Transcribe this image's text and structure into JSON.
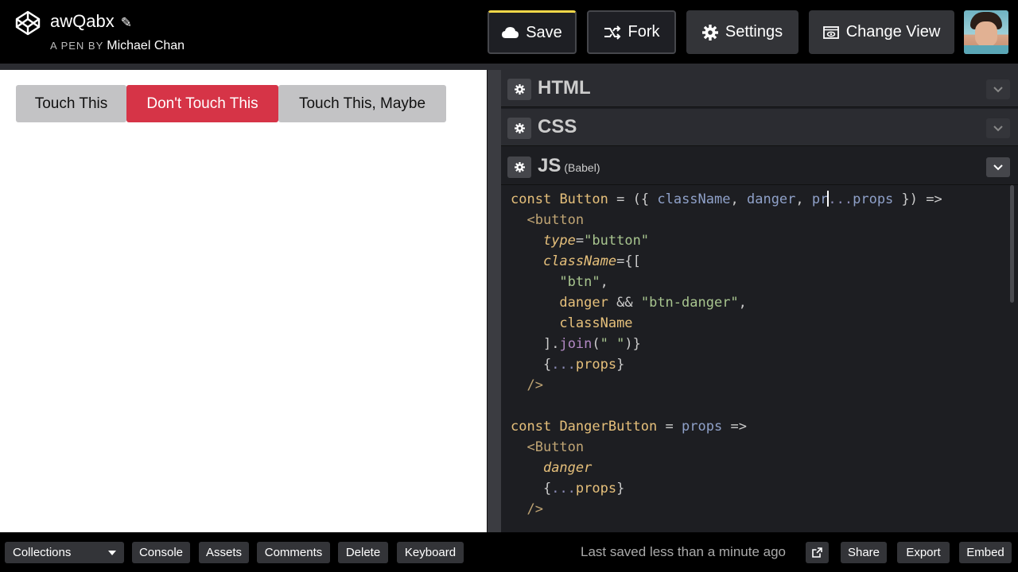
{
  "header": {
    "pen_title": "awQabx",
    "pen_by": "A PEN BY",
    "author": "Michael Chan",
    "buttons": {
      "save": "Save",
      "fork": "Fork",
      "settings": "Settings",
      "change_view": "Change View"
    },
    "colors": {
      "save_accent": "#f2d749",
      "background": "#000000"
    }
  },
  "preview": {
    "buttons": [
      {
        "label": "Touch This",
        "style": "default"
      },
      {
        "label": "Don't Touch This",
        "style": "danger"
      },
      {
        "label": "Touch This, Maybe",
        "style": "default"
      }
    ],
    "colors": {
      "danger": "#d63447",
      "default": "#c3c3c5"
    }
  },
  "editors": {
    "html": {
      "title": "HTML"
    },
    "css": {
      "title": "CSS"
    },
    "js": {
      "title": "JS",
      "preprocessor": "(Babel)"
    }
  },
  "code": {
    "lines": [
      "const Button = ({ className, danger, pr...props }) =>",
      "  <button",
      "    type=\"button\"",
      "    className={[",
      "      \"btn\",",
      "      danger && \"btn-danger\",",
      "      className",
      "    ].join(\" \")}",
      "    {...props}",
      "  />",
      "",
      "const DangerButton = props =>",
      "  <Button",
      "    danger",
      "    {...props}",
      "  />"
    ]
  },
  "footer": {
    "collections": "Collections",
    "console": "Console",
    "assets": "Assets",
    "comments": "Comments",
    "delete": "Delete",
    "keyboard": "Keyboard",
    "status": "Last saved less than a minute ago",
    "share": "Share",
    "export": "Export",
    "embed": "Embed"
  },
  "icons": [
    "codepen-logo-icon",
    "pencil-icon",
    "cloud-icon",
    "fork-icon",
    "gear-icon",
    "eye-window-icon",
    "chevron-down-icon",
    "external-link-icon",
    "caret-down-icon"
  ]
}
